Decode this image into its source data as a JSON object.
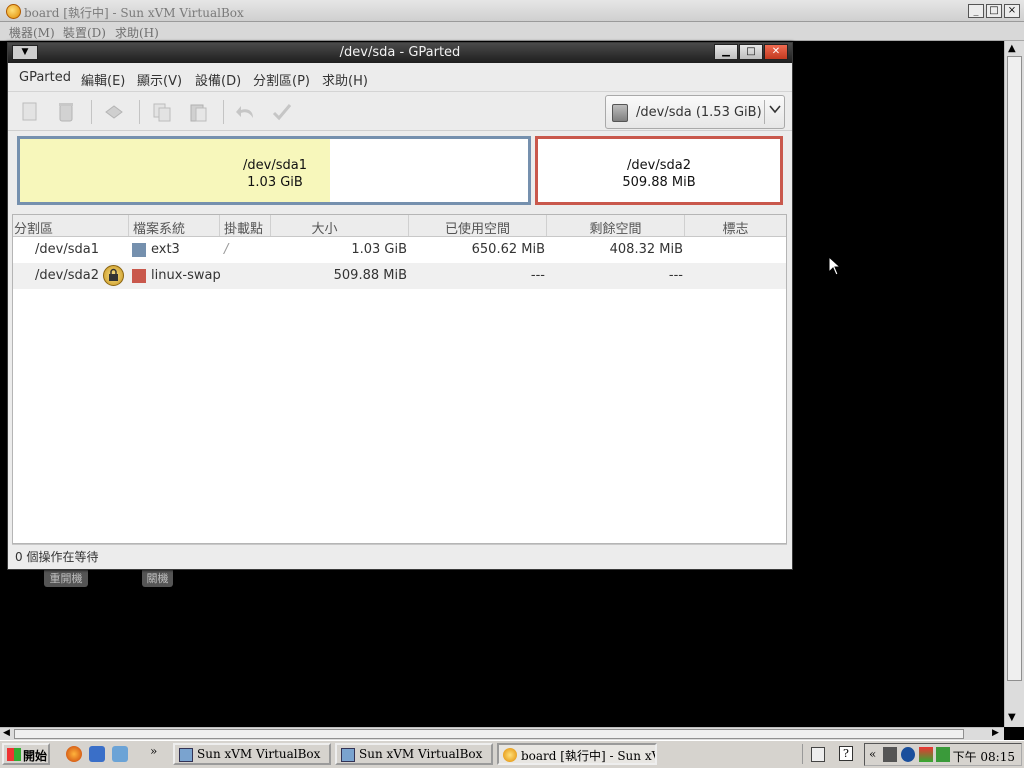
{
  "vbox": {
    "title": "board [執行中] - Sun xVM VirtualBox",
    "menu": [
      "機器(M)",
      "裝置(D)",
      "求助(H)"
    ],
    "controls": [
      "_",
      "□",
      "×"
    ]
  },
  "desktop": {
    "buttons": [
      "重開機",
      "關機"
    ]
  },
  "gparted": {
    "title": "/dev/sda - GParted",
    "window_controls": [
      "▁",
      "□",
      "✕"
    ],
    "menu": [
      "GParted",
      "編輯(E)",
      "顯示(V)",
      "設備(D)",
      "分割區(P)",
      "求助(H)"
    ],
    "device_combo": "/dev/sda  (1.53 GiB)",
    "partitions_map": [
      {
        "name": "/dev/sda1",
        "size": "1.03 GiB",
        "used_fraction": 0.61,
        "border_color": "#7590ae"
      },
      {
        "name": "/dev/sda2",
        "size": "509.88 MiB",
        "border_color": "#c9584c"
      }
    ],
    "columns": [
      "分割區",
      "檔案系統",
      "掛載點",
      "大小",
      "已使用空間",
      "剩餘空間",
      "標志"
    ],
    "rows": [
      {
        "partition": "/dev/sda1",
        "filesystem": "ext3",
        "fs_color": "#7590ae",
        "mountpoint": "/",
        "size": "1.03 GiB",
        "used": "650.62 MiB",
        "unused": "408.32 MiB",
        "flags": "",
        "locked": false
      },
      {
        "partition": "/dev/sda2",
        "filesystem": "linux-swap",
        "fs_color": "#c9584c",
        "mountpoint": "",
        "size": "509.88 MiB",
        "used": "---",
        "unused": "---",
        "flags": "",
        "locked": true
      }
    ],
    "status": "0 個操作在等待"
  },
  "taskbar": {
    "start_label": "開始",
    "more": "»",
    "tasks": [
      {
        "label": "Sun xVM VirtualBox",
        "active": false
      },
      {
        "label": "Sun xVM VirtualBox",
        "active": false
      },
      {
        "label": "board [執行中] - Sun xV...",
        "active": true
      }
    ],
    "tray_expand": "«",
    "clock": "下午 08:15"
  }
}
